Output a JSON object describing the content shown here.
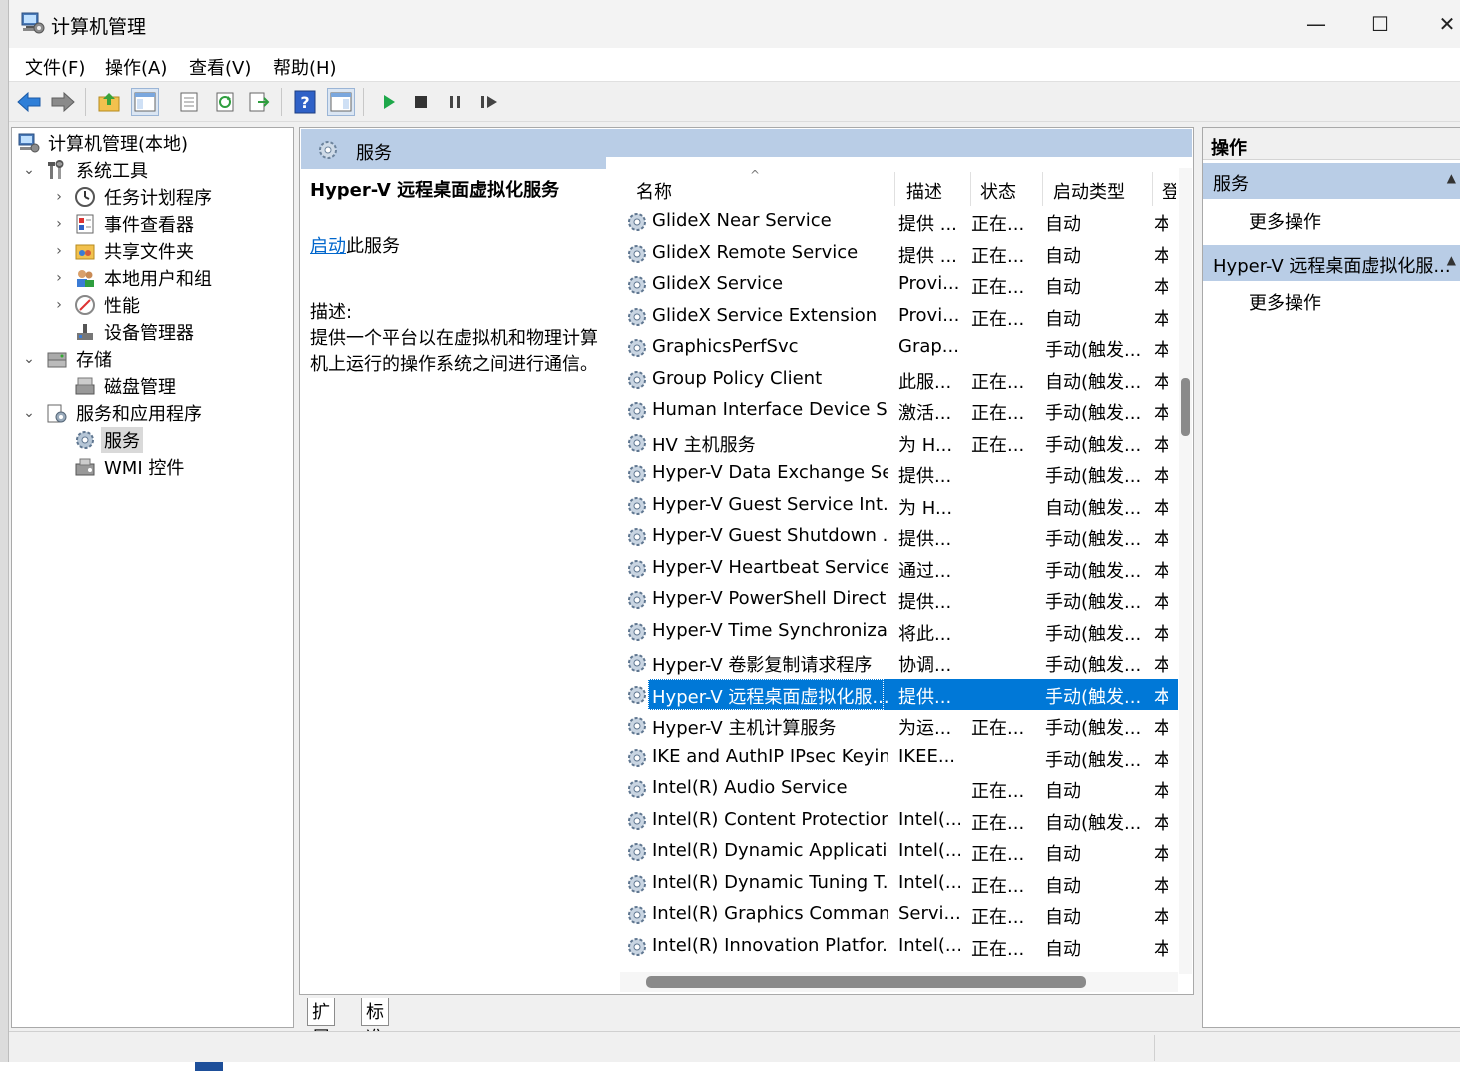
{
  "window": {
    "title": "计算机管理",
    "controls": {
      "minimize": "—",
      "maximize": "☐",
      "close": "✕"
    }
  },
  "menu": [
    "文件(F)",
    "操作(A)",
    "查看(V)",
    "帮助(H)"
  ],
  "toolbar": [
    "back-icon",
    "forward-icon",
    "up-folder-icon",
    "show-hide-tree-icon",
    "properties-icon",
    "refresh-icon",
    "export-icon",
    "help-icon",
    "show-hide-action-icon",
    "start-icon",
    "stop-icon",
    "pause-icon",
    "resume-icon"
  ],
  "tree": {
    "root": "计算机管理(本地)",
    "items": [
      {
        "label": "系统工具",
        "icon": "tools-icon"
      },
      {
        "label": "任务计划程序",
        "icon": "clock-icon"
      },
      {
        "label": "事件查看器",
        "icon": "event-viewer-icon"
      },
      {
        "label": "共享文件夹",
        "icon": "shared-folder-icon"
      },
      {
        "label": "本地用户和组",
        "icon": "users-icon"
      },
      {
        "label": "性能",
        "icon": "performance-icon"
      },
      {
        "label": "设备管理器",
        "icon": "device-manager-icon"
      },
      {
        "label": "存储",
        "icon": "storage-icon"
      },
      {
        "label": "磁盘管理",
        "icon": "disk-icon"
      },
      {
        "label": "服务和应用程序",
        "icon": "services-apps-icon"
      },
      {
        "label": "服务",
        "icon": "gear-icon"
      },
      {
        "label": "WMI 控件",
        "icon": "wmi-icon"
      }
    ]
  },
  "center": {
    "header": "服务",
    "selected_service_title": "Hyper-V 远程桌面虚拟化服务",
    "start_link": "启动",
    "start_suffix": "此服务",
    "desc_label": "描述:",
    "desc_text": "提供一个平台以在虚拟机和物理计算机上运行的操作系统之间进行通信。",
    "columns": [
      "名称",
      "描述",
      "状态",
      "启动类型",
      "登"
    ],
    "rows": [
      {
        "name": "GlideX Near Service",
        "desc": "提供 ...",
        "status": "正在...",
        "startup": "自动",
        "logon": "本"
      },
      {
        "name": "GlideX Remote Service",
        "desc": "提供 ...",
        "status": "正在...",
        "startup": "自动",
        "logon": "本"
      },
      {
        "name": "GlideX Service",
        "desc": "Provi...",
        "status": "正在...",
        "startup": "自动",
        "logon": "本"
      },
      {
        "name": "GlideX Service Extension",
        "desc": "Provi...",
        "status": "正在...",
        "startup": "自动",
        "logon": "本"
      },
      {
        "name": "GraphicsPerfSvc",
        "desc": "Grap...",
        "status": "",
        "startup": "手动(触发...",
        "logon": "本"
      },
      {
        "name": "Group Policy Client",
        "desc": "此服...",
        "status": "正在...",
        "startup": "自动(触发...",
        "logon": "本"
      },
      {
        "name": "Human Interface Device S...",
        "desc": "激活...",
        "status": "正在...",
        "startup": "手动(触发...",
        "logon": "本"
      },
      {
        "name": "HV 主机服务",
        "desc": "为 H...",
        "status": "正在...",
        "startup": "手动(触发...",
        "logon": "本"
      },
      {
        "name": "Hyper-V Data Exchange Se...",
        "desc": "提供...",
        "status": "",
        "startup": "手动(触发...",
        "logon": "本"
      },
      {
        "name": "Hyper-V Guest Service Int...",
        "desc": "为 H...",
        "status": "",
        "startup": "自动(触发...",
        "logon": "本"
      },
      {
        "name": "Hyper-V Guest Shutdown ...",
        "desc": "提供...",
        "status": "",
        "startup": "手动(触发...",
        "logon": "本"
      },
      {
        "name": "Hyper-V Heartbeat Service",
        "desc": "通过...",
        "status": "",
        "startup": "手动(触发...",
        "logon": "本"
      },
      {
        "name": "Hyper-V PowerShell Direct...",
        "desc": "提供...",
        "status": "",
        "startup": "手动(触发...",
        "logon": "本"
      },
      {
        "name": "Hyper-V Time Synchroniza...",
        "desc": "将此...",
        "status": "",
        "startup": "手动(触发...",
        "logon": "本"
      },
      {
        "name": "Hyper-V 卷影复制请求程序",
        "desc": "协调...",
        "status": "",
        "startup": "手动(触发...",
        "logon": "本"
      },
      {
        "name": "Hyper-V 远程桌面虚拟化服...",
        "desc": "提供...",
        "status": "",
        "startup": "手动(触发...",
        "logon": "本",
        "selected": true
      },
      {
        "name": "Hyper-V 主机计算服务",
        "desc": "为运...",
        "status": "正在...",
        "startup": "手动(触发...",
        "logon": "本"
      },
      {
        "name": "IKE and AuthIP IPsec Keyin...",
        "desc": "IKEE...",
        "status": "",
        "startup": "手动(触发...",
        "logon": "本"
      },
      {
        "name": "Intel(R) Audio Service",
        "desc": "",
        "status": "正在...",
        "startup": "自动",
        "logon": "本"
      },
      {
        "name": "Intel(R) Content Protection...",
        "desc": "Intel(...",
        "status": "正在...",
        "startup": "自动(触发...",
        "logon": "本"
      },
      {
        "name": "Intel(R) Dynamic Applicati...",
        "desc": "Intel(...",
        "status": "正在...",
        "startup": "自动",
        "logon": "本"
      },
      {
        "name": "Intel(R) Dynamic Tuning T...",
        "desc": "Intel(...",
        "status": "正在...",
        "startup": "自动",
        "logon": "本"
      },
      {
        "name": "Intel(R) Graphics Comman...",
        "desc": "Servi...",
        "status": "正在...",
        "startup": "自动",
        "logon": "本"
      },
      {
        "name": "Intel(R) Innovation Platfor...",
        "desc": "Intel(...",
        "status": "正在...",
        "startup": "自动",
        "logon": "本"
      }
    ],
    "tabs": [
      "扩展",
      "标准"
    ]
  },
  "actions": {
    "header": "操作",
    "sections": [
      {
        "title": "服务",
        "items": [
          "更多操作"
        ]
      },
      {
        "title": "Hyper-V 远程桌面虚拟化服...",
        "items": [
          "更多操作"
        ]
      }
    ]
  },
  "colors": {
    "selection": "#0078d7",
    "panel_header": "#b9cde6",
    "link": "#0066cc"
  }
}
